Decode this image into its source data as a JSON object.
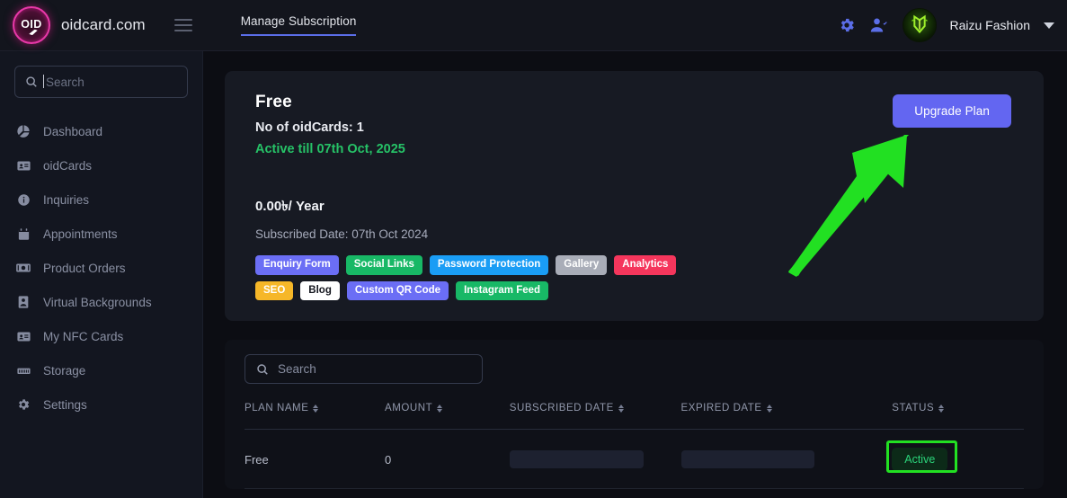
{
  "header": {
    "logo_text": "OID",
    "brand_name": "oidcard.com",
    "menu_icon": "hamburger-icon",
    "tabs": [
      {
        "label": "Manage Subscription",
        "active": true
      }
    ],
    "settings_icon": "gear-icon",
    "account_icon": "user-check-icon",
    "user_name": "Raizu Fashion",
    "caret_icon": "chevron-down-icon"
  },
  "sidebar": {
    "search": {
      "placeholder": "Search",
      "value": "",
      "icon": "search-icon"
    },
    "items": [
      {
        "label": "Dashboard",
        "icon": "pie-chart-icon"
      },
      {
        "label": "oidCards",
        "icon": "id-card-icon"
      },
      {
        "label": "Inquiries",
        "icon": "info-circle-icon"
      },
      {
        "label": "Appointments",
        "icon": "calendar-icon"
      },
      {
        "label": "Product Orders",
        "icon": "money-icon"
      },
      {
        "label": "Virtual Backgrounds",
        "icon": "portrait-icon"
      },
      {
        "label": "My NFC Cards",
        "icon": "id-card-icon"
      },
      {
        "label": "Storage",
        "icon": "server-icon"
      },
      {
        "label": "Settings",
        "icon": "gear-icon"
      }
    ]
  },
  "plan_card": {
    "title": "Free",
    "oidcards_label": "No of oidCards: 1",
    "active_till": "Active till 07th Oct, 2025",
    "price": "0.00৳/ Year",
    "subscribed_date": "Subscribed Date: 07th Oct 2024",
    "upgrade_button": "Upgrade Plan",
    "upgrade_button_color": "#6366f1",
    "features": [
      {
        "label": "Enquiry Form",
        "color": "#6b6ef5",
        "text_color": "#ffffff"
      },
      {
        "label": "Social Links",
        "color": "#18b866",
        "text_color": "#ffffff"
      },
      {
        "label": "Password Protection",
        "color": "#1a9df5",
        "text_color": "#ffffff"
      },
      {
        "label": "Gallery",
        "color": "#a9adb8",
        "text_color": "#ffffff"
      },
      {
        "label": "Analytics",
        "color": "#f5365c",
        "text_color": "#ffffff"
      },
      {
        "label": "SEO",
        "color": "#f6b728",
        "text_color": "#ffffff"
      },
      {
        "label": "Blog",
        "color": "#ffffff",
        "text_color": "#14161e"
      },
      {
        "label": "Custom QR Code",
        "color": "#6b6ef5",
        "text_color": "#ffffff"
      },
      {
        "label": "Instagram Feed",
        "color": "#18b866",
        "text_color": "#ffffff"
      }
    ]
  },
  "table": {
    "search": {
      "placeholder": "Search",
      "value": "",
      "icon": "search-icon"
    },
    "columns": [
      {
        "label": "PLAN NAME",
        "sortable": true
      },
      {
        "label": "AMOUNT",
        "sortable": true
      },
      {
        "label": "SUBSCRIBED DATE",
        "sortable": true
      },
      {
        "label": "EXPIRED DATE",
        "sortable": true
      },
      {
        "label": "STATUS",
        "sortable": true
      }
    ],
    "rows": [
      {
        "plan_name": "Free",
        "amount": "0",
        "subscribed_date": "",
        "expired_date": "",
        "status": "Active",
        "status_color": "#2bd47a"
      }
    ]
  },
  "annotation": {
    "arrow_color": "#22e022",
    "highlight_color": "#22e022",
    "arrow_points_to": "Upgrade Plan",
    "highlight_target": "Active"
  }
}
